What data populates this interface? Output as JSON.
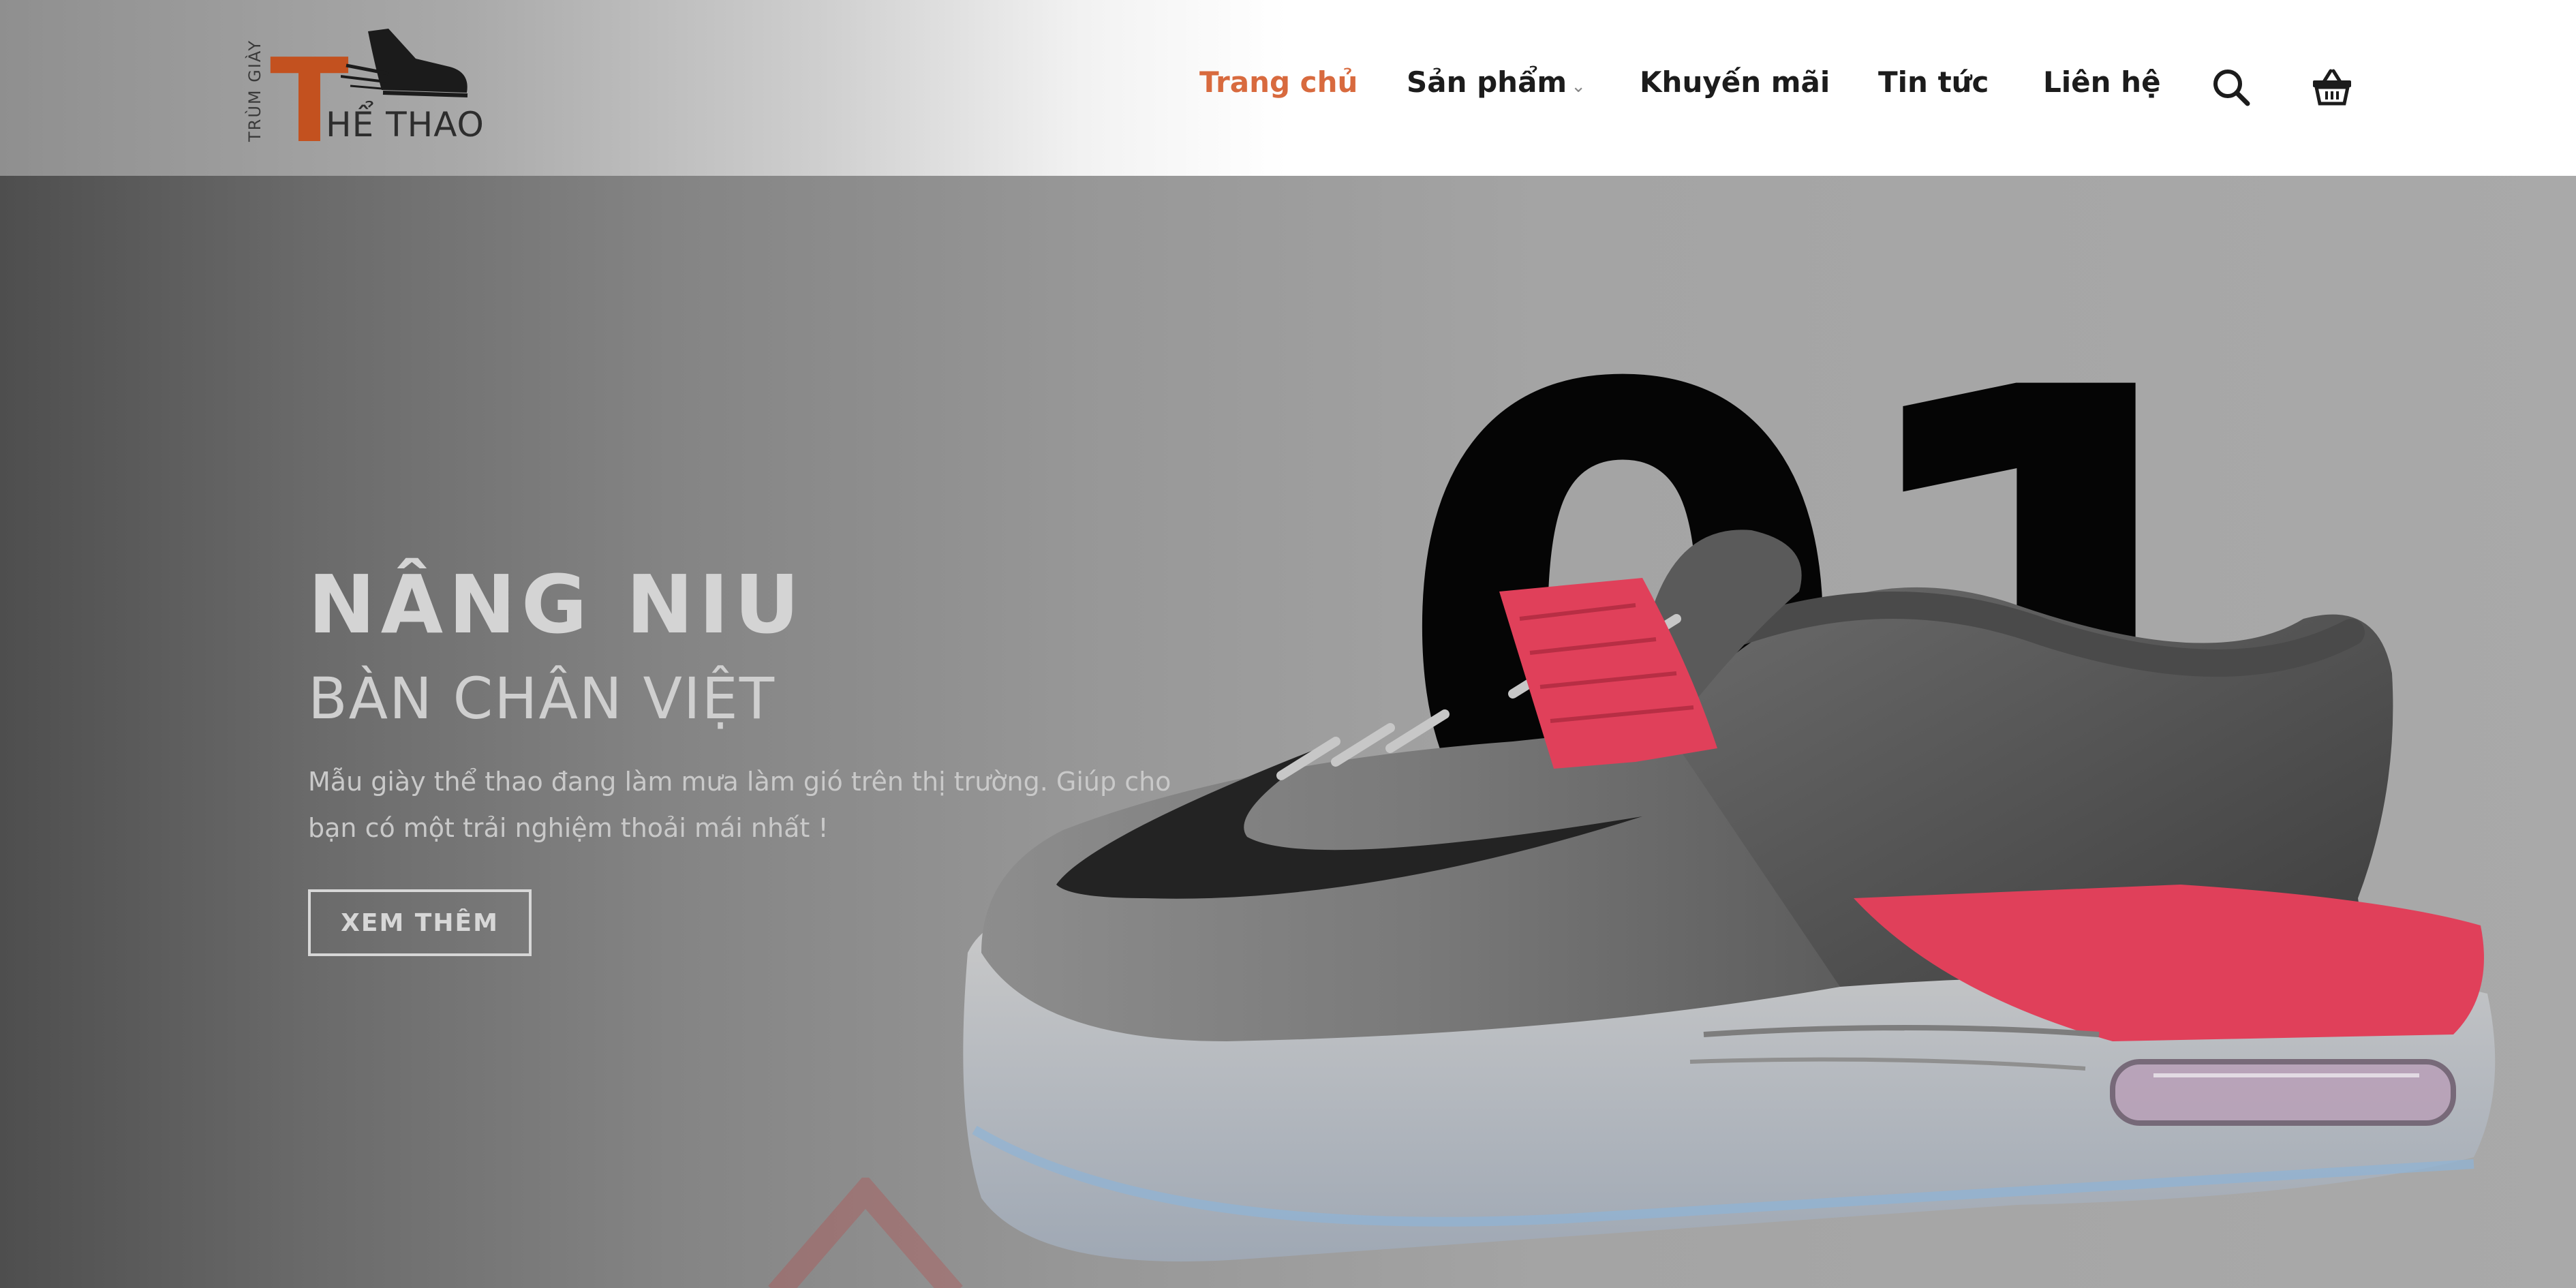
{
  "brand": {
    "vertical_text": "TRÙM GIÀY",
    "initial": "T",
    "name": "HỂ THAO"
  },
  "nav": {
    "items": [
      {
        "label": "Trang chủ",
        "active": true
      },
      {
        "label": "Sản phẩm",
        "dropdown": true
      },
      {
        "label": "Khuyến mãi"
      },
      {
        "label": "Tin tức"
      },
      {
        "label": "Liên hệ"
      }
    ],
    "icons": [
      "search-icon",
      "cart-basket-icon"
    ]
  },
  "hero": {
    "title": "NÂNG NIU",
    "subtitle": "BÀN CHÂN VIỆT",
    "description": "Mẫu giày thể thao đang làm mưa làm gió trên thị trường. Giúp cho bạn có một trải nghiệm thoải mái nhất !",
    "button_label": "XEM THÊM",
    "big_number": "01",
    "image": "basketball-sneaker-grey-red"
  },
  "colors": {
    "accent": "#d86a3e",
    "logo_orange": "#c3511f",
    "shoe_red": "#e0405a"
  }
}
